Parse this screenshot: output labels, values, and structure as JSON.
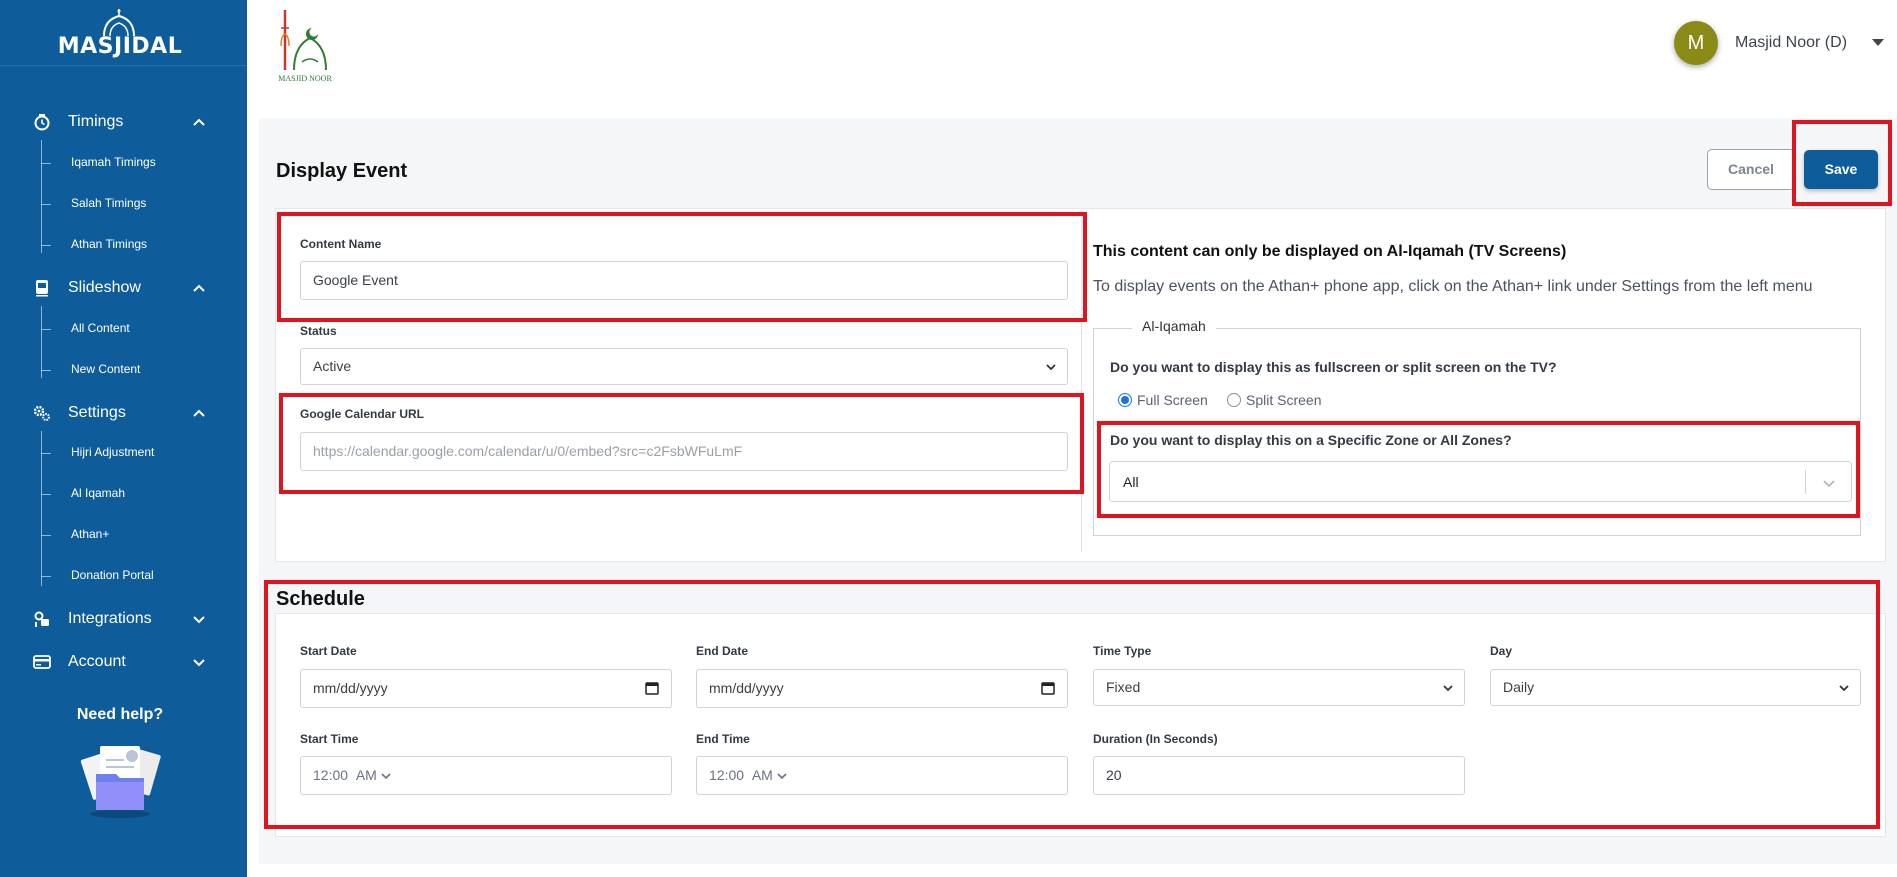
{
  "sidebar": {
    "logo_text": "MASJIDAL",
    "sections": {
      "timings": {
        "label": "Timings",
        "icon": "clock-icon",
        "items": [
          "Iqamah Timings",
          "Salah Timings",
          "Athan Timings"
        ]
      },
      "slideshow": {
        "label": "Slideshow",
        "icon": "slideshow-icon",
        "items": [
          "All Content",
          "New Content"
        ]
      },
      "settings": {
        "label": "Settings",
        "icon": "gears-icon",
        "items": [
          "Hijri Adjustment",
          "Al Iqamah",
          "Athan+",
          "Donation Portal"
        ]
      },
      "integrations": {
        "label": "Integrations",
        "icon": "integrations-icon"
      },
      "account": {
        "label": "Account",
        "icon": "credit-card-icon"
      }
    },
    "help": "Need help?"
  },
  "header": {
    "brand_text": "MASJID NOOR",
    "avatar_letter": "M",
    "user_name": "Masjid Noor (D)"
  },
  "page": {
    "title": "Display Event",
    "cancel_label": "Cancel",
    "save_label": "Save"
  },
  "form": {
    "content_name_label": "Content Name",
    "content_name_value": "Google Event",
    "status_label": "Status",
    "status_value": "Active",
    "gcal_label": "Google Calendar URL",
    "gcal_placeholder": "https://calendar.google.com/calendar/u/0/embed?src=c2FsbWFuLmF"
  },
  "aliqamah": {
    "info_title": "This content can only be displayed on Al-Iqamah (TV Screens)",
    "info_text": "To display events on the Athan+ phone app, click on the Athan+ link under Settings from the left menu",
    "legend": "Al-Iqamah",
    "screen_question": "Do you want to display this as fullscreen or split screen on the TV?",
    "full_screen": "Full Screen",
    "split_screen": "Split Screen",
    "selected_mode": "Full Screen",
    "zone_question": "Do you want to display this on a Specific Zone or All Zones?",
    "zone_value": "All"
  },
  "schedule": {
    "title": "Schedule",
    "start_date_label": "Start Date",
    "start_date_value": "mm/dd/yyyy",
    "end_date_label": "End Date",
    "end_date_value": "mm/dd/yyyy",
    "time_type_label": "Time Type",
    "time_type_value": "Fixed",
    "day_label": "Day",
    "day_value": "Daily",
    "start_time_label": "Start Time",
    "start_time_value": "12:00",
    "start_time_ampm": "AM",
    "end_time_label": "End Time",
    "end_time_value": "12:00",
    "end_time_ampm": "AM",
    "duration_label": "Duration (In Seconds)",
    "duration_value": "20"
  },
  "colors": {
    "sidebar_bg": "#0f5c9a",
    "primary": "#0f5c9a",
    "highlight_border": "#e0141e",
    "avatar_bg": "#8a8a16"
  }
}
